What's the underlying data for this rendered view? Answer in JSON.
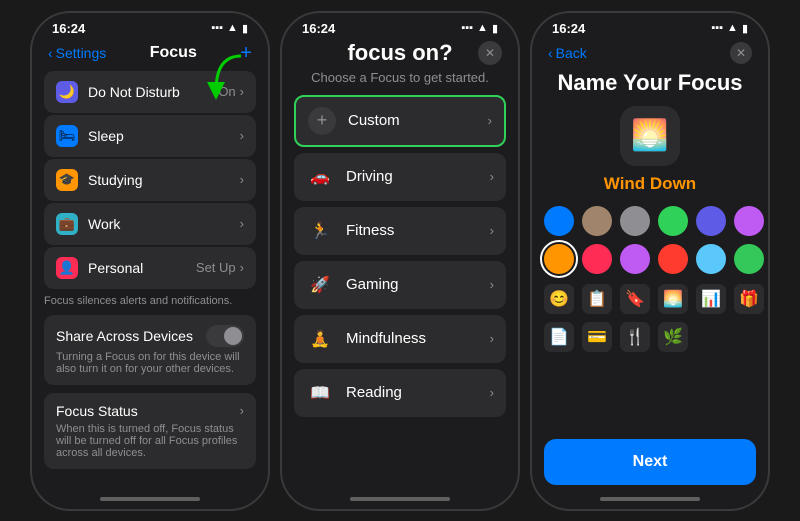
{
  "phone1": {
    "statusBar": {
      "time": "16:24",
      "icons": "●■ ▲ ⊙"
    },
    "nav": {
      "back": "Settings",
      "title": "Focus",
      "add": "+"
    },
    "items": [
      {
        "icon": "🌙",
        "iconBg": "purple",
        "label": "Do Not Disturb",
        "right": "On",
        "hasChevron": true
      },
      {
        "icon": "🛏",
        "iconBg": "blue",
        "label": "Sleep",
        "right": "",
        "hasChevron": true
      },
      {
        "icon": "🎓",
        "iconBg": "orange",
        "label": "Studying",
        "right": "",
        "hasChevron": true
      },
      {
        "icon": "💼",
        "iconBg": "teal",
        "label": "Work",
        "right": "",
        "hasChevron": true
      },
      {
        "icon": "👤",
        "iconBg": "pink",
        "label": "Personal",
        "right": "Set Up",
        "hasChevron": true
      }
    ],
    "infoText": "Focus silences alerts and notifications.",
    "shareCard": {
      "title": "Share Across Devices",
      "desc": "Turning a Focus on for this device will also turn it on for your other devices."
    },
    "focusStatusCard": {
      "title": "Focus Status",
      "desc": "When this is turned off, Focus status will be turned off for all Focus profiles across all devices."
    }
  },
  "phone2": {
    "statusBar": {
      "time": "16:24"
    },
    "title": "focus on?",
    "subtitle": "Choose a Focus to get started.",
    "options": [
      {
        "type": "custom",
        "label": "Custom",
        "highlighted": true
      },
      {
        "icon": "🚗",
        "label": "Driving",
        "iconBg": "#888"
      },
      {
        "icon": "🏃",
        "label": "Fitness",
        "iconBg": "#30D158"
      },
      {
        "icon": "🚀",
        "label": "Gaming",
        "iconBg": "#5E5CE6"
      },
      {
        "icon": "🧘",
        "label": "Mindfulness",
        "iconBg": "#FF9500"
      },
      {
        "icon": "📖",
        "label": "Reading",
        "iconBg": "#FF9500"
      }
    ]
  },
  "phone3": {
    "statusBar": {
      "time": "16:24"
    },
    "nav": {
      "back": "Back"
    },
    "title": "Name Your Focus",
    "focusIcon": "🌅",
    "focusName": "Wind Down",
    "colors": [
      {
        "hex": "#007AFF",
        "selected": false
      },
      {
        "hex": "#A0856C",
        "selected": false
      },
      {
        "hex": "#8e8e93",
        "selected": false
      },
      {
        "hex": "#30D158",
        "selected": false
      },
      {
        "hex": "#5E5CE6",
        "selected": false
      },
      {
        "hex": "#BF5AF2",
        "selected": false
      },
      {
        "hex": "#FF9500",
        "selected": true
      },
      {
        "hex": "#FF2D55",
        "selected": false
      },
      {
        "hex": "#BF5AF2",
        "selected": false
      },
      {
        "hex": "#FF3B30",
        "selected": false
      },
      {
        "hex": "#5AC8FA",
        "selected": false
      },
      {
        "hex": "#34C759",
        "selected": false
      }
    ],
    "icons": [
      "😊",
      "📋",
      "🔖",
      "🌅",
      "📊",
      "🎁",
      "📄",
      "💳",
      "🍴",
      "🌿"
    ],
    "nextLabel": "Next"
  }
}
